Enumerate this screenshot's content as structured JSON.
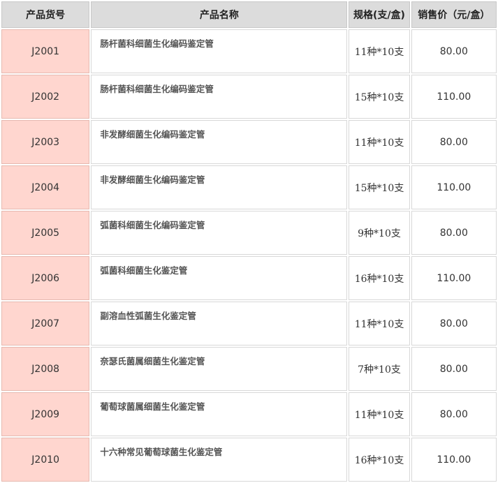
{
  "headers": {
    "code": "产品货号",
    "name": "产品名称",
    "spec": "规格(支/盒)",
    "price": "销售价（元/盒）"
  },
  "rows": [
    {
      "code": "J2001",
      "name": "肠杆菌科细菌生化编码鉴定管",
      "spec": "11种*10支",
      "price": "80.00"
    },
    {
      "code": "J2002",
      "name": "肠杆菌科细菌生化编码鉴定管",
      "spec": "15种*10支",
      "price": "110.00"
    },
    {
      "code": "J2003",
      "name": "非发酵细菌生化编码鉴定管",
      "spec": "11种*10支",
      "price": "80.00"
    },
    {
      "code": "J2004",
      "name": "非发酵细菌生化编码鉴定管",
      "spec": "15种*10支",
      "price": "110.00"
    },
    {
      "code": "J2005",
      "name": "弧菌科细菌生化编码鉴定管",
      "spec": "9种*10支",
      "price": "80.00"
    },
    {
      "code": "J2006",
      "name": "弧菌科细菌生化鉴定管",
      "spec": "16种*10支",
      "price": "110.00"
    },
    {
      "code": "J2007",
      "name": "副溶血性弧菌生化鉴定管",
      "spec": "11种*10支",
      "price": "80.00"
    },
    {
      "code": "J2008",
      "name": "奈瑟氏菌属细菌生化鉴定管",
      "spec": "7种*10支",
      "price": "80.00"
    },
    {
      "code": "J2009",
      "name": "葡萄球菌属细菌生化鉴定管",
      "spec": "11种*10支",
      "price": "80.00"
    },
    {
      "code": "J2010",
      "name": "十六种常见葡萄球菌生化鉴定管",
      "spec": "16种*10支",
      "price": "110.00"
    }
  ]
}
